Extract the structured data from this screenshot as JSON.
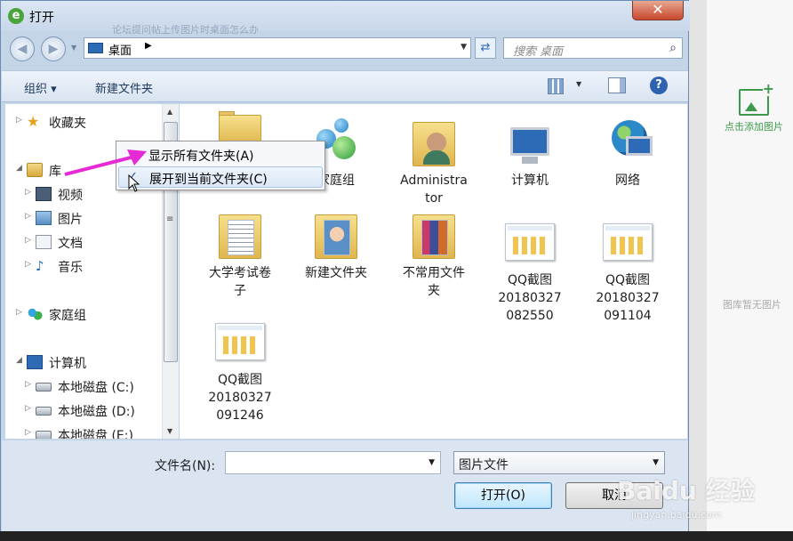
{
  "window": {
    "title": "打开",
    "close_label": "✕",
    "blur_hint": "论坛提问帖上传图片时桌面怎么办"
  },
  "address": {
    "location": "桌面",
    "separator": "▶",
    "search_placeholder": "搜索 桌面"
  },
  "toolbar": {
    "organize": "组织 ▾",
    "new_folder": "新建文件夹"
  },
  "nav_tree": [
    {
      "label": "收藏夹",
      "icon": "star-icon"
    },
    {
      "label": "库",
      "icon": "library-icon"
    },
    {
      "label": "视频",
      "icon": "video-icon"
    },
    {
      "label": "图片",
      "icon": "pictures-icon"
    },
    {
      "label": "文档",
      "icon": "documents-icon"
    },
    {
      "label": "音乐",
      "icon": "music-icon"
    },
    {
      "label": "家庭组",
      "icon": "homegroup-icon"
    },
    {
      "label": "计算机",
      "icon": "computer-icon"
    },
    {
      "label": "本地磁盘 (C:)",
      "icon": "drive-icon"
    },
    {
      "label": "本地磁盘 (D:)",
      "icon": "drive-icon"
    },
    {
      "label": "本地磁盘 (E:)",
      "icon": "drive-icon"
    }
  ],
  "files": [
    {
      "label": "",
      "type": "folder"
    },
    {
      "label": "家庭组",
      "type": "homegroup"
    },
    {
      "label": "Administra\ntor",
      "type": "user-folder"
    },
    {
      "label": "计算机",
      "type": "computer"
    },
    {
      "label": "网络",
      "type": "network"
    },
    {
      "label": "大学考试卷\n子",
      "type": "folder-lines"
    },
    {
      "label": "新建文件夹",
      "type": "folder-face"
    },
    {
      "label": "不常用文件\n夹",
      "type": "folder-multi"
    },
    {
      "label": "QQ截图\n20180327\n082550",
      "type": "screenshot"
    },
    {
      "label": "QQ截图\n20180327\n091104",
      "type": "screenshot"
    },
    {
      "label": "QQ截图\n20180327\n091246",
      "type": "screenshot"
    }
  ],
  "context_menu": {
    "show_all_folders": "显示所有文件夹(A)",
    "expand_to_current": "展开到当前文件夹(C)",
    "check_mark": "✓"
  },
  "bottom": {
    "filename_label": "文件名(N):",
    "filename_value": "",
    "filetype": "图片文件",
    "open_button": "打开(O)",
    "cancel_button": "取消"
  },
  "side_panel": {
    "add_image": "点击添加图片",
    "no_image": "图库暂无图片"
  },
  "watermark": {
    "brand": "Baidu 经验",
    "url": "jingyan.baidu.com"
  },
  "colors": {
    "accent": "#3d9a4c",
    "arrow": "#e62ad6",
    "selection": "#dbe7f6"
  }
}
